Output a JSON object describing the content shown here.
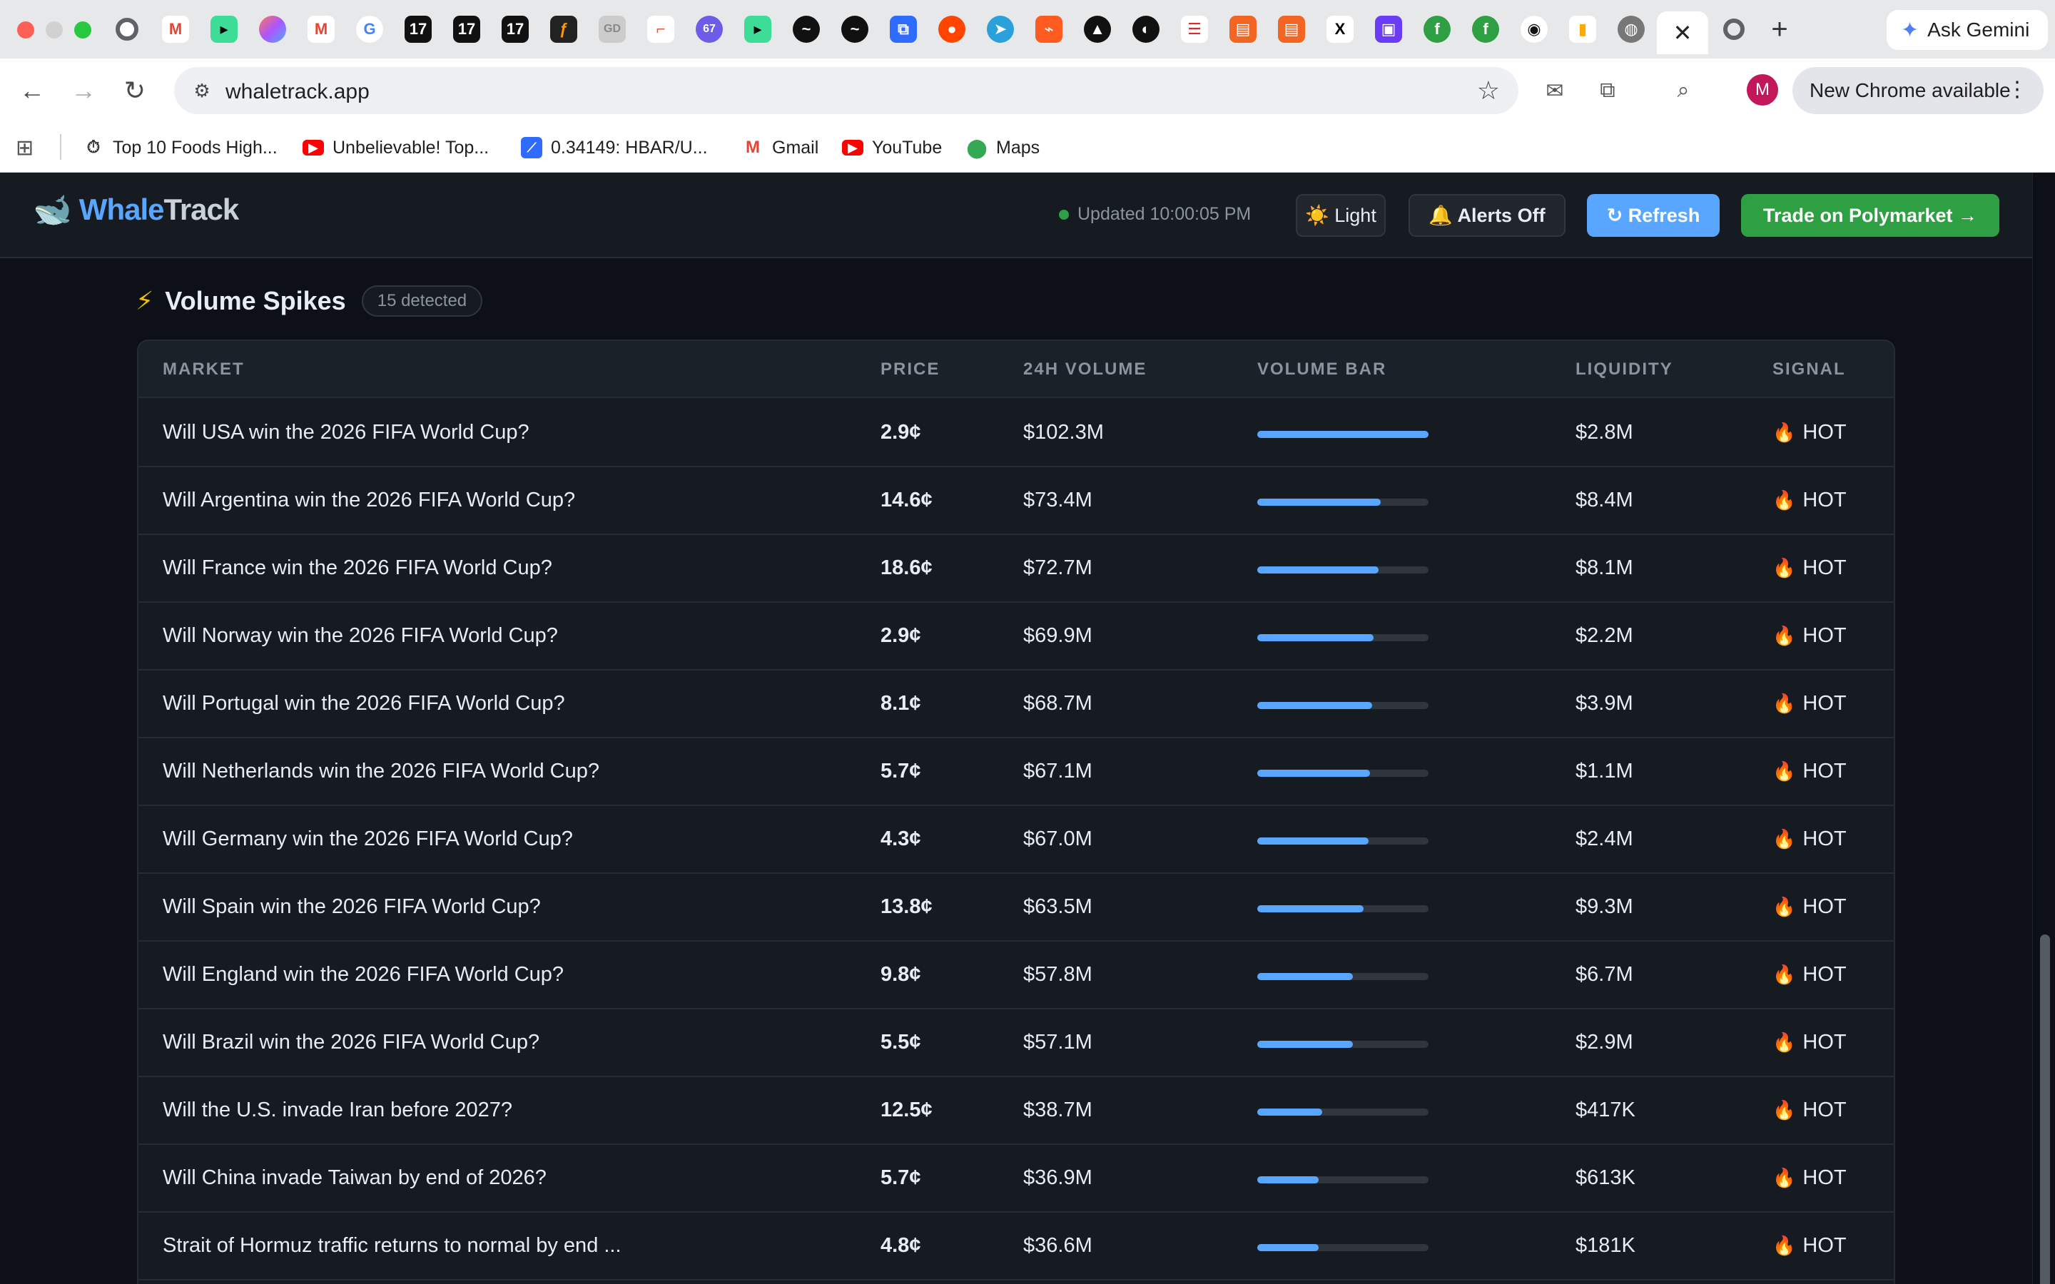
{
  "browser": {
    "url": "whaletrack.app",
    "gemini_label": "Ask Gemini",
    "new_chrome_label": "New Chrome available",
    "avatar_letter": "M",
    "active_tab_close": "✕",
    "bookmarks": [
      {
        "label": "Top 10 Foods High...",
        "icon": "stopwatch-icon"
      },
      {
        "label": "Unbelievable! Top...",
        "icon": "youtube-icon"
      },
      {
        "label": "0.34149: HBAR/U...",
        "icon": "chart-icon"
      },
      {
        "label": "Gmail",
        "icon": "gmail-icon"
      },
      {
        "label": "YouTube",
        "icon": "youtube-icon"
      },
      {
        "label": "Maps",
        "icon": "maps-pin-icon"
      }
    ]
  },
  "app": {
    "logo_whale": "Whale",
    "logo_track": "Track",
    "updated": "Updated 10:00:05 PM",
    "light_label": "☀️ Light",
    "alerts_label": "🔔 Alerts Off",
    "refresh_label": "↻ Refresh",
    "trade_label": "Trade on Polymarket →",
    "colors": {
      "accent": "#58a6ff",
      "green": "#2ea043",
      "background": "#0d1117",
      "panel": "#161b22"
    }
  },
  "section": {
    "title": "Volume Spikes",
    "badge": "15 detected",
    "columns": [
      "MARKET",
      "PRICE",
      "24H VOLUME",
      "VOLUME BAR",
      "LIQUIDITY",
      "SIGNAL"
    ]
  },
  "rows": [
    {
      "market": "Will USA win the 2026 FIFA World Cup?",
      "price": "2.9¢",
      "volume": "$102.3M",
      "volume_fraction": 1.0,
      "liquidity": "$2.8M",
      "signal": "HOT"
    },
    {
      "market": "Will Argentina win the 2026 FIFA World Cup?",
      "price": "14.6¢",
      "volume": "$73.4M",
      "volume_fraction": 0.72,
      "liquidity": "$8.4M",
      "signal": "HOT"
    },
    {
      "market": "Will France win the 2026 FIFA World Cup?",
      "price": "18.6¢",
      "volume": "$72.7M",
      "volume_fraction": 0.71,
      "liquidity": "$8.1M",
      "signal": "HOT"
    },
    {
      "market": "Will Norway win the 2026 FIFA World Cup?",
      "price": "2.9¢",
      "volume": "$69.9M",
      "volume_fraction": 0.68,
      "liquidity": "$2.2M",
      "signal": "HOT"
    },
    {
      "market": "Will Portugal win the 2026 FIFA World Cup?",
      "price": "8.1¢",
      "volume": "$68.7M",
      "volume_fraction": 0.67,
      "liquidity": "$3.9M",
      "signal": "HOT"
    },
    {
      "market": "Will Netherlands win the 2026 FIFA World Cup?",
      "price": "5.7¢",
      "volume": "$67.1M",
      "volume_fraction": 0.66,
      "liquidity": "$1.1M",
      "signal": "HOT"
    },
    {
      "market": "Will Germany win the 2026 FIFA World Cup?",
      "price": "4.3¢",
      "volume": "$67.0M",
      "volume_fraction": 0.65,
      "liquidity": "$2.4M",
      "signal": "HOT"
    },
    {
      "market": "Will Spain win the 2026 FIFA World Cup?",
      "price": "13.8¢",
      "volume": "$63.5M",
      "volume_fraction": 0.62,
      "liquidity": "$9.3M",
      "signal": "HOT"
    },
    {
      "market": "Will England win the 2026 FIFA World Cup?",
      "price": "9.8¢",
      "volume": "$57.8M",
      "volume_fraction": 0.56,
      "liquidity": "$6.7M",
      "signal": "HOT"
    },
    {
      "market": "Will Brazil win the 2026 FIFA World Cup?",
      "price": "5.5¢",
      "volume": "$57.1M",
      "volume_fraction": 0.56,
      "liquidity": "$2.9M",
      "signal": "HOT"
    },
    {
      "market": "Will the U.S. invade Iran before 2027?",
      "price": "12.5¢",
      "volume": "$38.7M",
      "volume_fraction": 0.38,
      "liquidity": "$417K",
      "signal": "HOT"
    },
    {
      "market": "Will China invade Taiwan by end of 2026?",
      "price": "5.7¢",
      "volume": "$36.9M",
      "volume_fraction": 0.36,
      "liquidity": "$613K",
      "signal": "HOT"
    },
    {
      "market": "Strait of Hormuz traffic returns to normal by end ...",
      "price": "4.8¢",
      "volume": "$36.6M",
      "volume_fraction": 0.36,
      "liquidity": "$181K",
      "signal": "HOT"
    }
  ]
}
